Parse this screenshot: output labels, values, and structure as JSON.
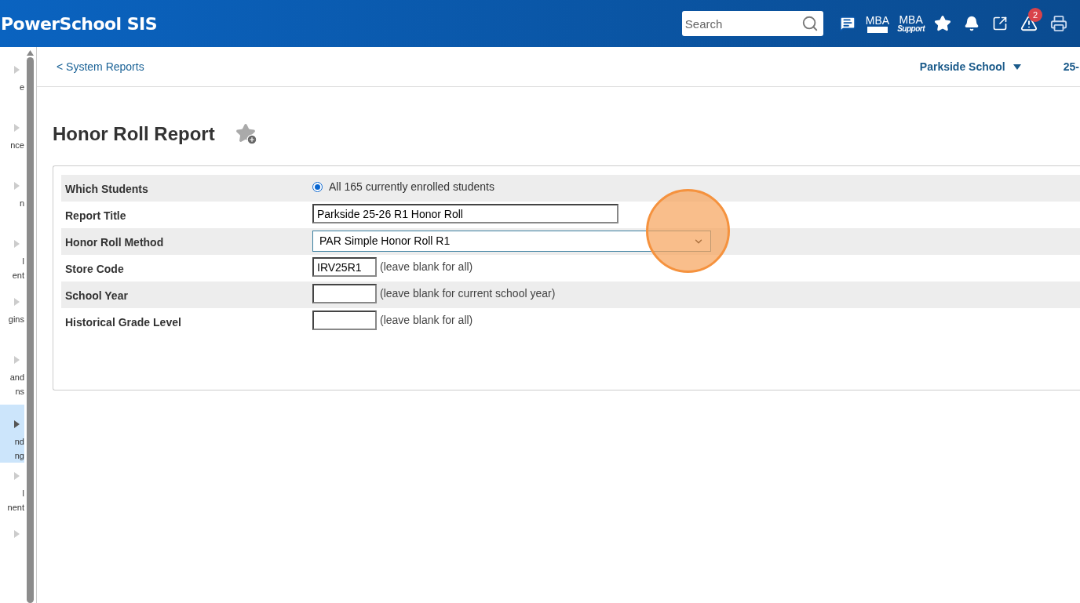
{
  "header": {
    "brand": "PowerSchool SIS",
    "search": {
      "placeholder": "Search"
    },
    "mba_label": "MBA",
    "mba_support_label": "MBA",
    "mba_support_sub": "Support",
    "alerts_badge": "2"
  },
  "sidebar": {
    "items": [
      {
        "lines": [
          "e"
        ],
        "selected": false
      },
      {
        "lines": [
          "nce"
        ],
        "selected": false
      },
      {
        "lines": [
          "n"
        ],
        "selected": false
      },
      {
        "lines": [
          "l",
          "ent"
        ],
        "selected": false
      },
      {
        "lines": [
          "gins"
        ],
        "selected": false
      },
      {
        "lines": [
          "and",
          "ns"
        ],
        "selected": false
      },
      {
        "lines": [
          "nd",
          "ng"
        ],
        "selected": true
      },
      {
        "lines": [
          "l",
          "nent"
        ],
        "selected": false
      },
      {
        "selected": false
      }
    ]
  },
  "breadcrumb": "< System Reports",
  "school_selector": "Parkside School",
  "term_selector": "25-",
  "page_title": "Honor Roll Report",
  "form": {
    "rows": [
      {
        "label": "Which Students",
        "kind": "radio",
        "text": "All 165 currently enrolled students",
        "checked": true
      },
      {
        "label": "Report Title",
        "kind": "text",
        "value": "Parkside 25-26 R1 Honor Roll"
      },
      {
        "label": "Honor Roll Method",
        "kind": "select",
        "value": "PAR Simple Honor Roll R1"
      },
      {
        "label": "Store Code",
        "kind": "short",
        "value": "IRV25R1",
        "hint": "(leave blank for all)"
      },
      {
        "label": "School Year",
        "kind": "short",
        "hint": "(leave blank for current school year)"
      },
      {
        "label": "Historical Grade Level",
        "kind": "short",
        "hint": "(leave blank for all)"
      }
    ]
  },
  "click_highlight": {
    "kind": "circle"
  }
}
